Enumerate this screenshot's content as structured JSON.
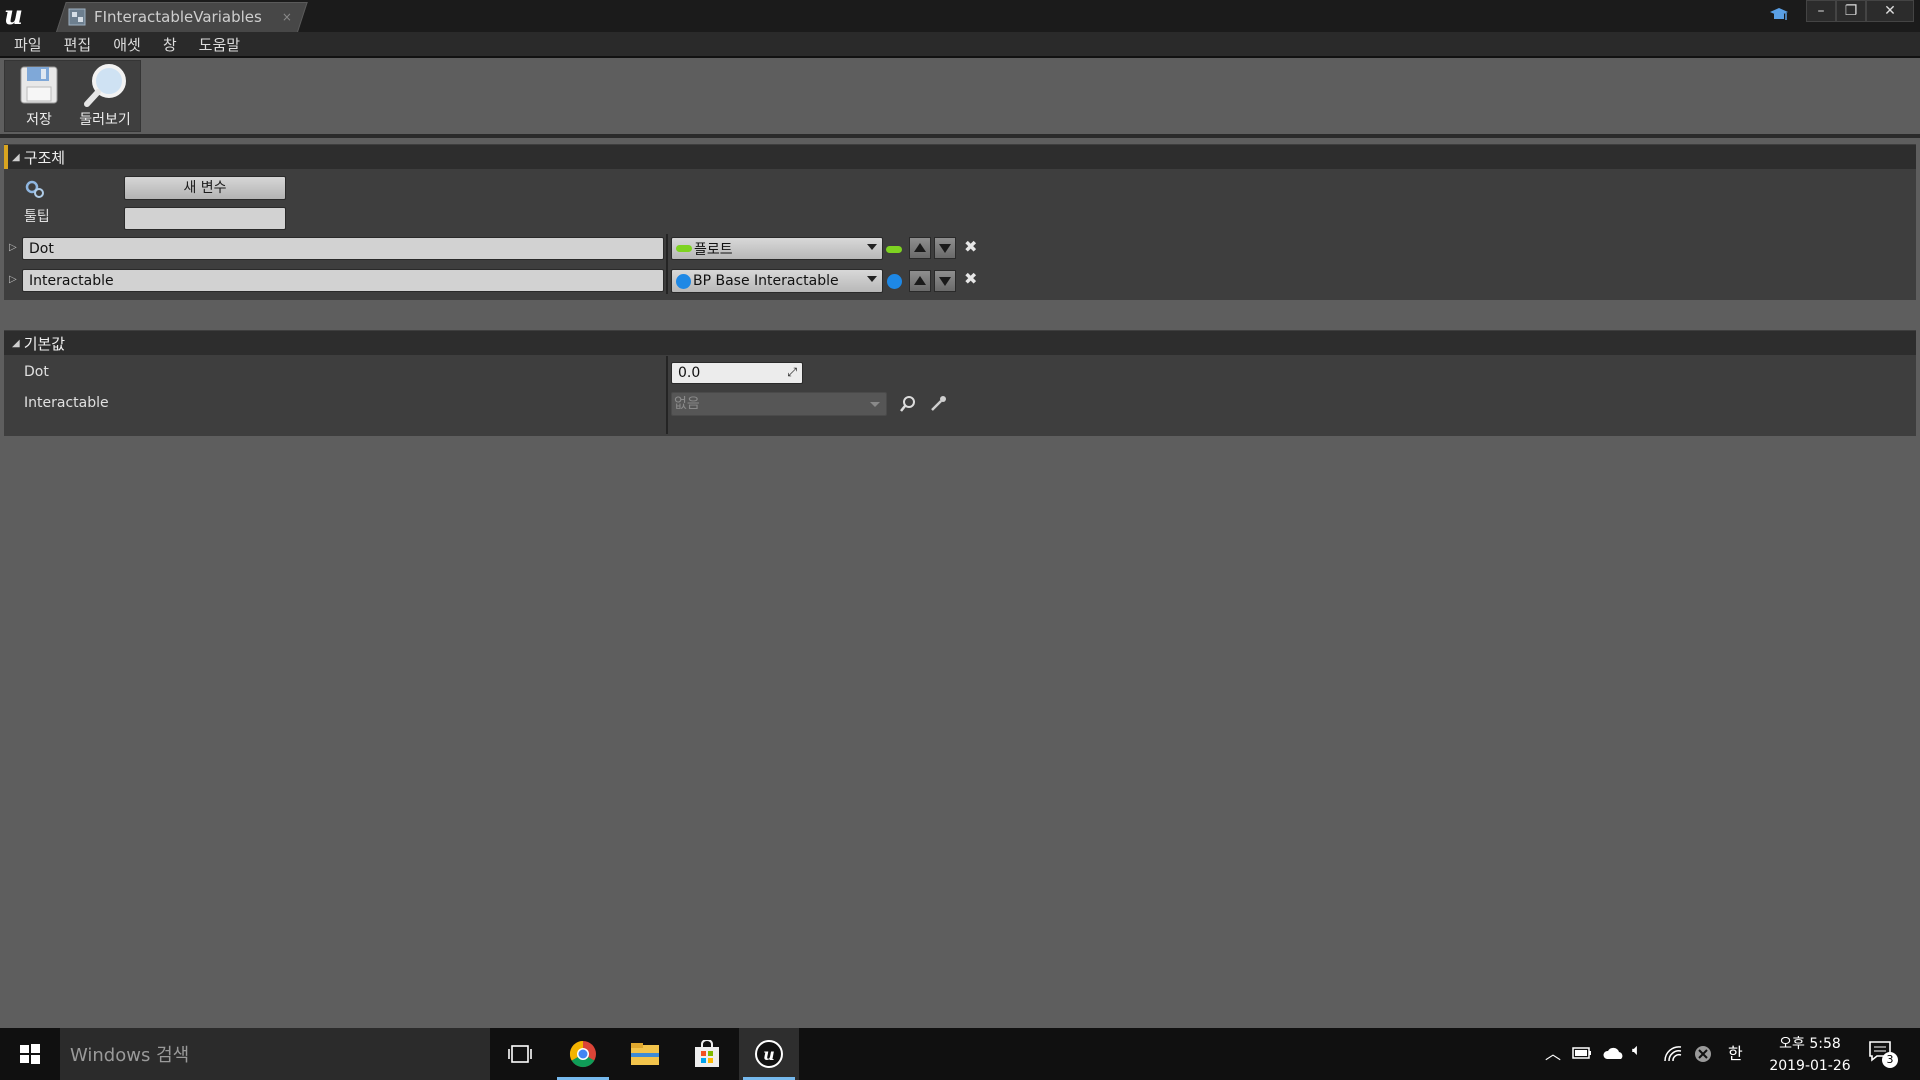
{
  "window": {
    "tab_title": "FInteractableVariables",
    "tab_close": "×",
    "controls": {
      "minimize": "–",
      "restore": "❐",
      "close": "✕"
    }
  },
  "menu": [
    "파일",
    "편집",
    "애셋",
    "창",
    "도움말"
  ],
  "toolbar": {
    "save_label": "저장",
    "browse_label": "둘러보기"
  },
  "structure": {
    "section_title": "구조체",
    "new_variable_button": "새 변수",
    "tooltip_label": "툴팁",
    "tooltip_value": "",
    "variables": [
      {
        "name": "Dot",
        "type": "플로트",
        "type_color": "#7ed321"
      },
      {
        "name": "Interactable",
        "type": "BP Base Interactable",
        "type_color": "#1e88e5"
      }
    ]
  },
  "defaults": {
    "section_title": "기본값",
    "dot_label": "Dot",
    "dot_value": "0.0",
    "interactable_label": "Interactable",
    "interactable_value": "없음"
  },
  "taskbar": {
    "search_placeholder": "Windows 검색",
    "ime_indicator": "한",
    "clock_time": "오후 5:58",
    "clock_date": "2019-01-26",
    "notification_count": "3"
  },
  "colors": {
    "accent": "#d9a520",
    "float_type": "#7ed321",
    "object_type": "#1e88e5"
  }
}
